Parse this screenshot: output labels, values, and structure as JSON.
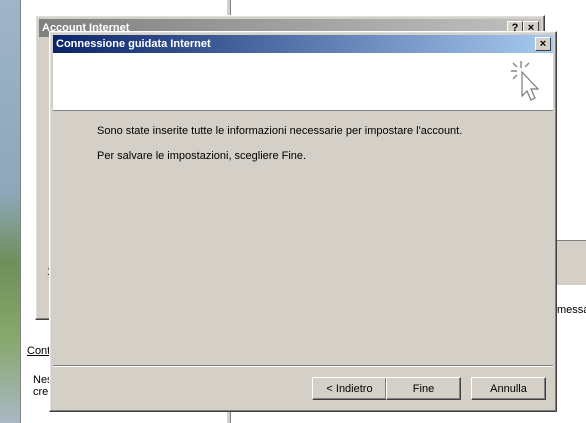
{
  "background_window": {
    "partial_labels": [
      "Cont",
      "Nes",
      "cre"
    ],
    "partial_right_label": "messa",
    "partial_left_digit": "1"
  },
  "account_dialog": {
    "title": "Account Internet",
    "help_label": "?",
    "close_label": "×"
  },
  "wizard": {
    "title": "Connessione guidata Internet",
    "close_label": "×",
    "message_1": "Sono state inserite tutte le informazioni necessarie per impostare l'account.",
    "message_2": "Per salvare le impostazioni, scegliere Fine.",
    "buttons": {
      "back": "< Indietro",
      "finish": "Fine",
      "cancel": "Annulla"
    }
  },
  "colors": {
    "title_active": "#0a246a",
    "title_inactive": "#808080",
    "face": "#d4d0c8"
  }
}
